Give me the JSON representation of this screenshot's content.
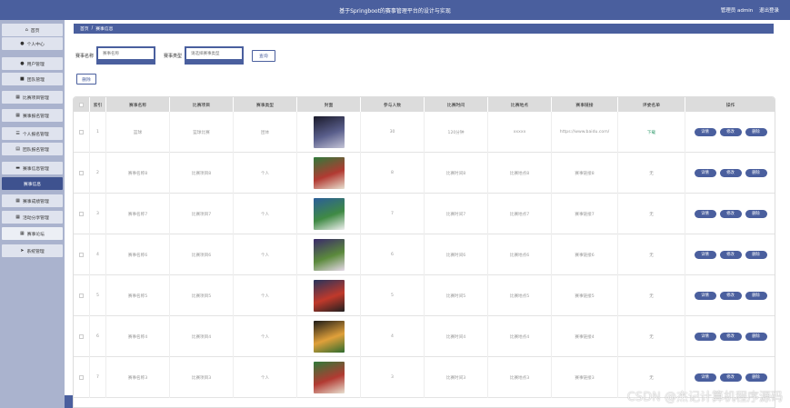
{
  "header": {
    "title": "基于Springboot的赛事管理平台的设计与实现",
    "user_text": "管理员 admin",
    "logout": "退出登录"
  },
  "sidebar": {
    "items": [
      {
        "label": "首页",
        "icon": "home-icon",
        "glyph": "⌂"
      },
      {
        "label": "个人中心",
        "icon": "user-icon",
        "glyph": "●"
      },
      {
        "label": "用户管理",
        "icon": "user-icon",
        "glyph": "●"
      },
      {
        "label": "团队管理",
        "icon": "team-icon",
        "glyph": "■"
      },
      {
        "label": "比赛项目管理",
        "icon": "grid-icon",
        "glyph": "▦"
      },
      {
        "label": "赛事报名管理",
        "icon": "grid-icon",
        "glyph": "▦"
      },
      {
        "label": "个人报名管理",
        "icon": "list-icon",
        "glyph": "☰"
      },
      {
        "label": "团队报名管理",
        "icon": "doc-icon",
        "glyph": "▤"
      },
      {
        "label": "赛事信息管理",
        "icon": "monitor-icon",
        "glyph": "▬"
      },
      {
        "label": "赛事信息",
        "icon": "",
        "glyph": ""
      },
      {
        "label": "赛事成绩管理",
        "icon": "grid-icon",
        "glyph": "▦"
      },
      {
        "label": "活动分享管理",
        "icon": "grid-icon",
        "glyph": "▦"
      },
      {
        "label": "赛事论坛",
        "icon": "grid-icon",
        "glyph": "▦"
      },
      {
        "label": "系统管理",
        "icon": "send-icon",
        "glyph": "➤"
      }
    ]
  },
  "breadcrumb": {
    "home": "首页",
    "sep": "/",
    "current": "赛事信息"
  },
  "search": {
    "name_label": "赛事名称",
    "name_placeholder": "赛事名称",
    "type_label": "赛事类型",
    "type_placeholder": "请选择赛事类型",
    "query_button": "查询"
  },
  "toolbar": {
    "delete_label": "删除"
  },
  "table": {
    "headers": [
      "索引",
      "赛事名称",
      "比赛项目",
      "赛事类型",
      "封面",
      "参与人数",
      "比赛时间",
      "比赛地点",
      "赛事链接",
      "评委名单",
      "操作"
    ],
    "actions": [
      "详情",
      "修改",
      "删除"
    ],
    "rows": [
      {
        "index": "1",
        "name": "篮球",
        "project": "篮球比赛",
        "type": "团体",
        "cover": "team-huddle",
        "people": "30",
        "time": "120分钟",
        "place": "xxxxx",
        "link": "https://www.baidu.com/",
        "judges": "下载"
      },
      {
        "index": "2",
        "name": "赛事名称8",
        "project": "比赛项目8",
        "type": "个人",
        "cover": "football-player",
        "people": "8",
        "time": "比赛时间8",
        "place": "比赛地点8",
        "link": "赛事链接8",
        "judges": "无"
      },
      {
        "index": "3",
        "name": "赛事名称7",
        "project": "比赛项目7",
        "type": "个人",
        "cover": "football-match",
        "people": "7",
        "time": "比赛时间7",
        "place": "比赛地点7",
        "link": "赛事链接7",
        "judges": "无"
      },
      {
        "index": "4",
        "name": "赛事名称6",
        "project": "比赛项目6",
        "type": "个人",
        "cover": "football-duel",
        "people": "6",
        "time": "比赛时间6",
        "place": "比赛地点6",
        "link": "赛事链接6",
        "judges": "无"
      },
      {
        "index": "5",
        "name": "赛事名称5",
        "project": "比赛项目5",
        "type": "个人",
        "cover": "football-red",
        "people": "5",
        "time": "比赛时间5",
        "place": "比赛地点5",
        "link": "赛事链接5",
        "judges": "无"
      },
      {
        "index": "6",
        "name": "赛事名称4",
        "project": "比赛项目4",
        "type": "个人",
        "cover": "stadium-glow",
        "people": "4",
        "time": "比赛时间4",
        "place": "比赛地点4",
        "link": "赛事链接4",
        "judges": "无"
      },
      {
        "index": "7",
        "name": "赛事名称3",
        "project": "比赛项目3",
        "type": "个人",
        "cover": "football-player",
        "people": "3",
        "time": "比赛时间3",
        "place": "比赛地点3",
        "link": "赛事链接3",
        "judges": "无"
      }
    ]
  },
  "watermark": "CSDN @杰记计算机程序源码",
  "colors": {
    "primary": "#4a5f9e",
    "sidebar_bg": "#aab3ce",
    "download_green": "#2e9a6a"
  }
}
